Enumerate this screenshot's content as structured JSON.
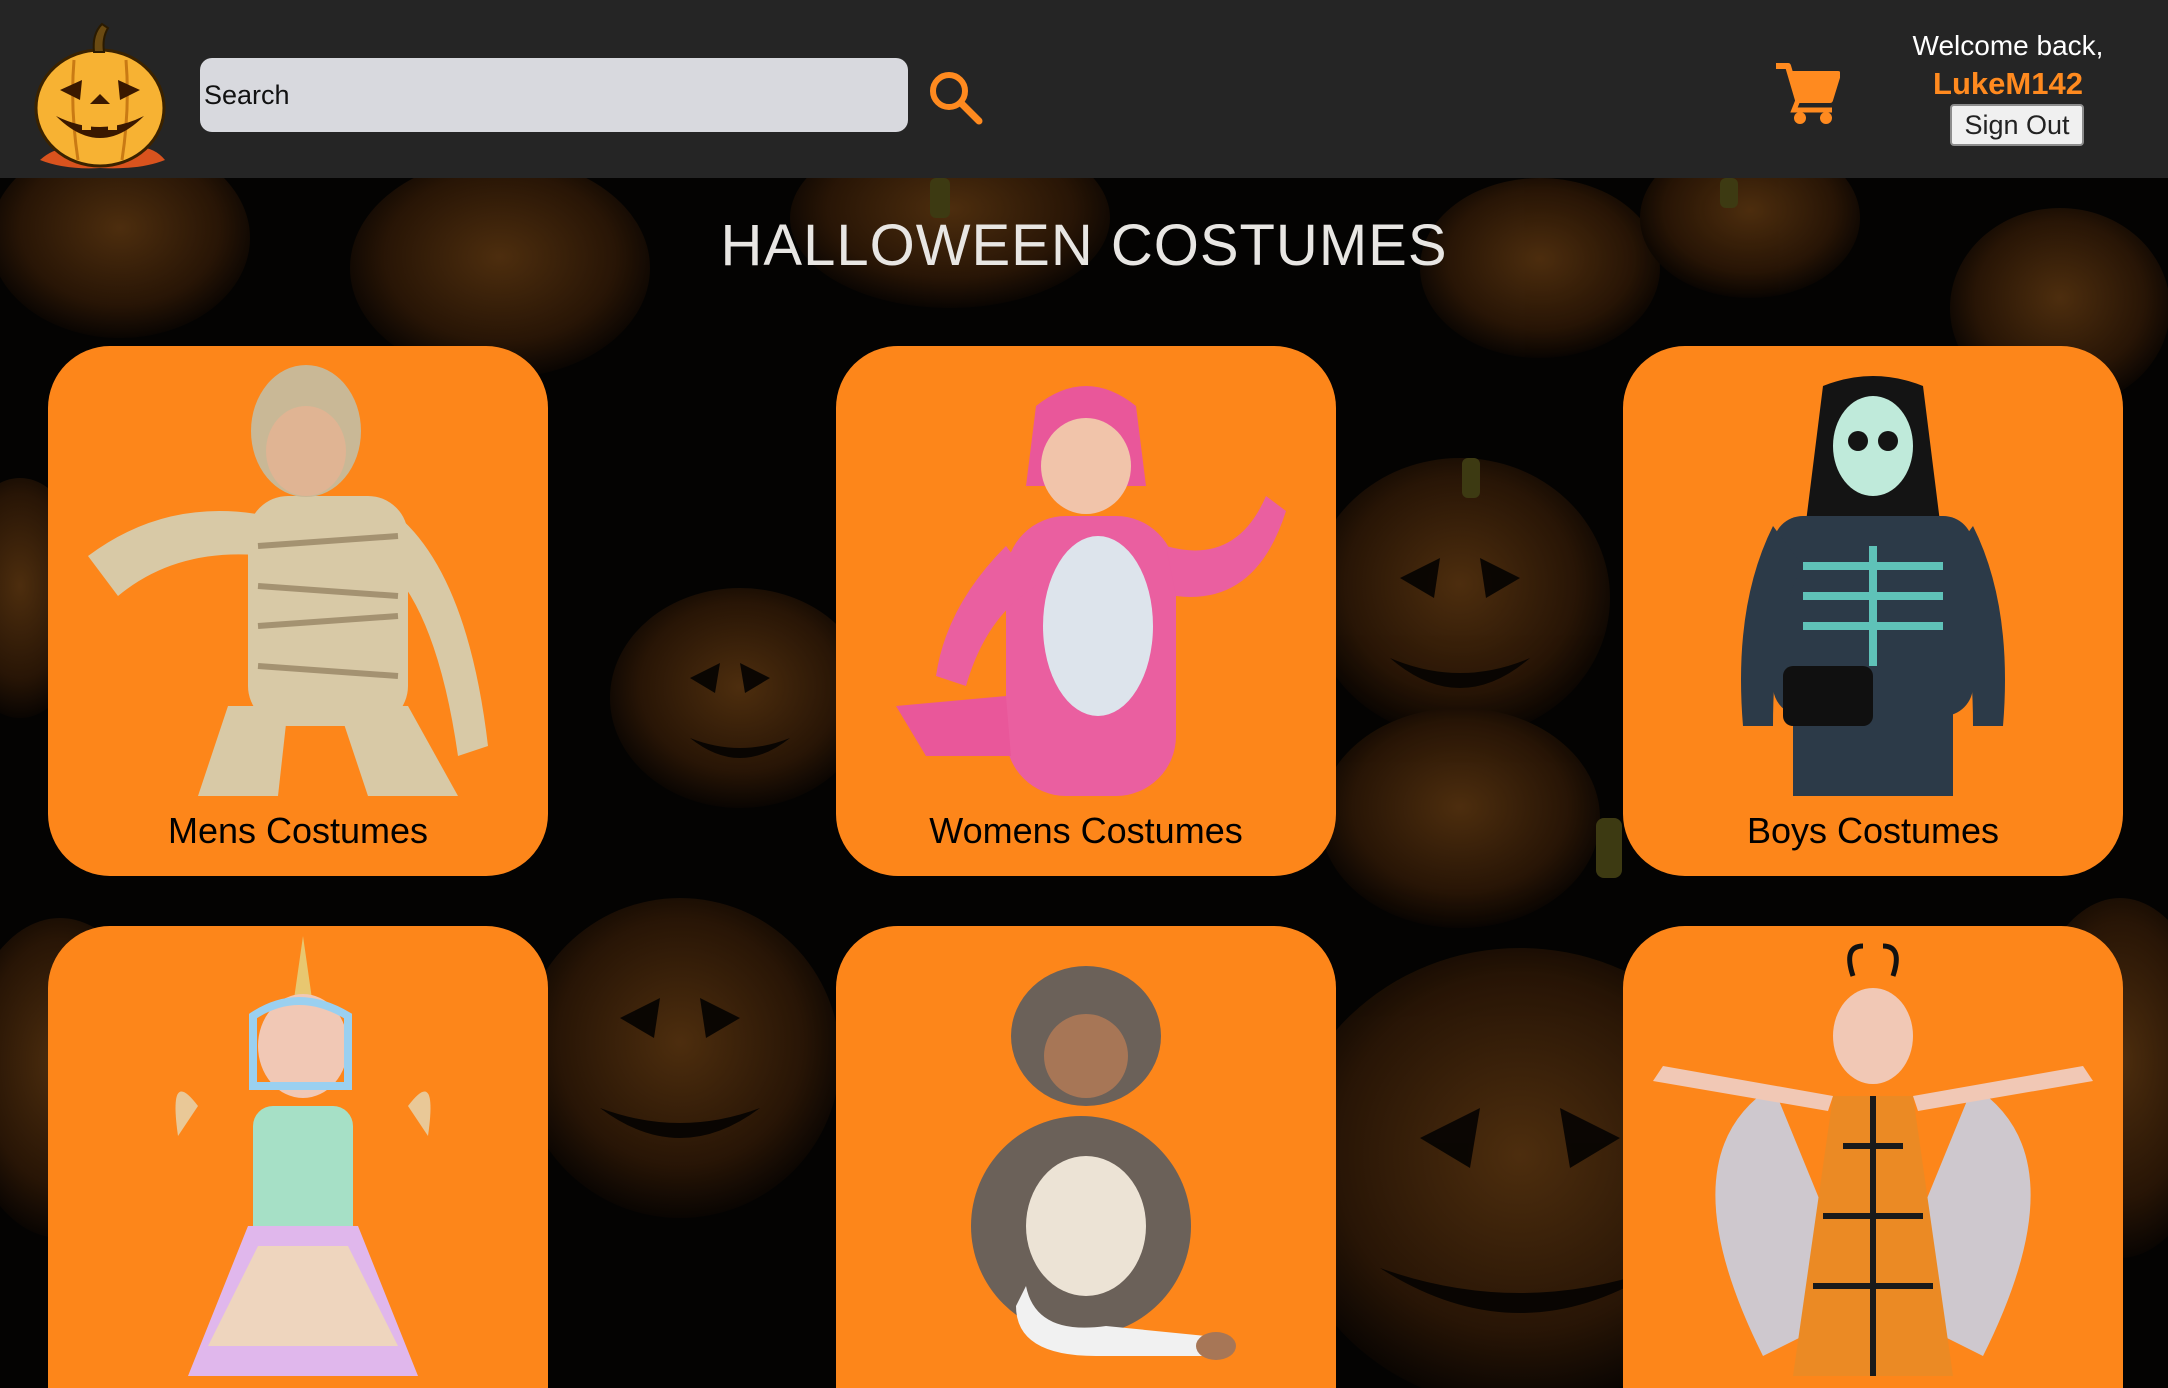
{
  "header": {
    "logo_icon": "jack-o-lantern-logo-icon",
    "search": {
      "placeholder": "Search",
      "value": ""
    },
    "search_icon": "search-icon",
    "cart_icon": "shopping-cart-icon",
    "welcome_text": "Welcome back,",
    "username": "LukeM142",
    "sign_out_label": "Sign Out"
  },
  "main": {
    "title": "HALLOWEEN COSTUMES",
    "background": "pumpkin-pattern",
    "categories": [
      {
        "label": "Mens Costumes",
        "image": "mummy-costume"
      },
      {
        "label": "Womens Costumes",
        "image": "pink-dinosaur-costume"
      },
      {
        "label": "Boys Costumes",
        "image": "skeleton-costume"
      },
      {
        "label": "",
        "image": "unicorn-costume"
      },
      {
        "label": "",
        "image": "hedgehog-baby-costume"
      },
      {
        "label": "",
        "image": "butterfly-costume"
      }
    ]
  },
  "colors": {
    "header_bg": "#252525",
    "accent": "#ff8a1f",
    "card_bg": "#fd861a",
    "page_bg": "#040302",
    "search_bg": "#d8d9de"
  }
}
